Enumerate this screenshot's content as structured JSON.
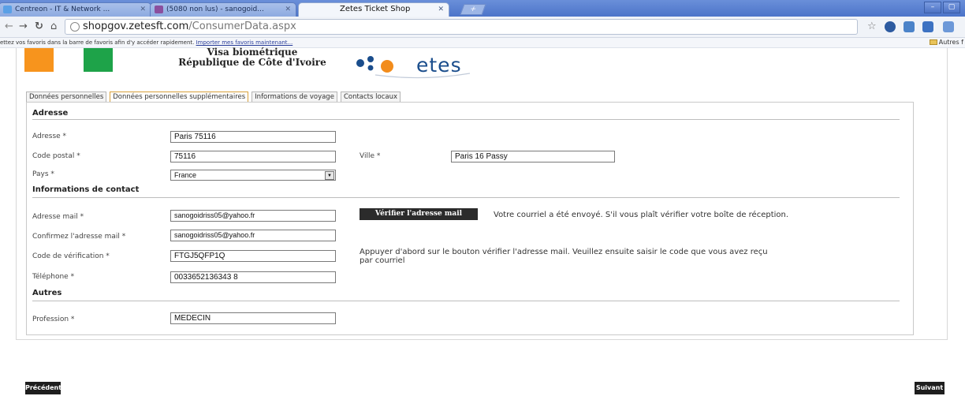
{
  "browser": {
    "tabs": [
      {
        "title": "Centreon - IT & Network ...",
        "favicon_color": "#5aa0e6"
      },
      {
        "title": "(5080 non lus) - sanogoid...",
        "favicon_color": "#8b4f9e"
      },
      {
        "title": "Zetes Ticket Shop",
        "favicon_color": "#f3f6fb"
      }
    ],
    "address": {
      "domain": "shopgov.zetesft.com",
      "path": "/ConsumerData.aspx"
    },
    "bookmark_message": "ettez vos favoris dans la barre de favoris afin d'y accéder rapidement.",
    "bookmark_link": "Importer mes favoris maintenant...",
    "other_bookmarks": "Autres f"
  },
  "header": {
    "visa_line1": "Visa biométrique",
    "visa_line2": "République de Côte d'Ivoire",
    "logo_text": "etes",
    "flag_colors": [
      "#f7941d",
      "#ffffff",
      "#1ea349"
    ]
  },
  "tabs": [
    {
      "label": "Données personnelles",
      "active": false
    },
    {
      "label": "Données personnelles supplémentaires",
      "active": true
    },
    {
      "label": "Informations de voyage",
      "active": false
    },
    {
      "label": "Contacts locaux",
      "active": false
    }
  ],
  "sections": {
    "adresse": "Adresse",
    "contact": "Informations de contact",
    "autres": "Autres"
  },
  "fields": {
    "adresse": {
      "label": "Adresse *",
      "value": "Paris 75116"
    },
    "code_postal": {
      "label": "Code postal *",
      "value": "75116"
    },
    "ville": {
      "label": "Ville *",
      "value": "Paris 16 Passy"
    },
    "pays": {
      "label": "Pays *",
      "value": "France"
    },
    "email": {
      "label": "Adresse mail *",
      "value": "sanogoidriss05@yahoo.fr"
    },
    "email_confirm": {
      "label": "Confirmez l'adresse mail *",
      "value": "sanogoidriss05@yahoo.fr"
    },
    "code_verif": {
      "label": "Code de vérification *",
      "value": "FTGJ5QFP1Q"
    },
    "telephone": {
      "label": "Téléphone *",
      "value": "0033652136343 8"
    },
    "profession": {
      "label": "Profession *",
      "value": "MEDECIN"
    }
  },
  "verify_button": "Vérifier l'adresse mail",
  "verify_sent_note": "Votre courriel a été envoyé. S'il vous plaît vérifier votre boîte de réception.",
  "verify_hint_line1": "Appuyer d'abord sur le bouton vérifier l'adresse mail. Veuillez ensuite saisir le code que vous avez reçu",
  "verify_hint_line2": "par courriel",
  "nav": {
    "previous": "Précédent",
    "next": "Suivant"
  }
}
